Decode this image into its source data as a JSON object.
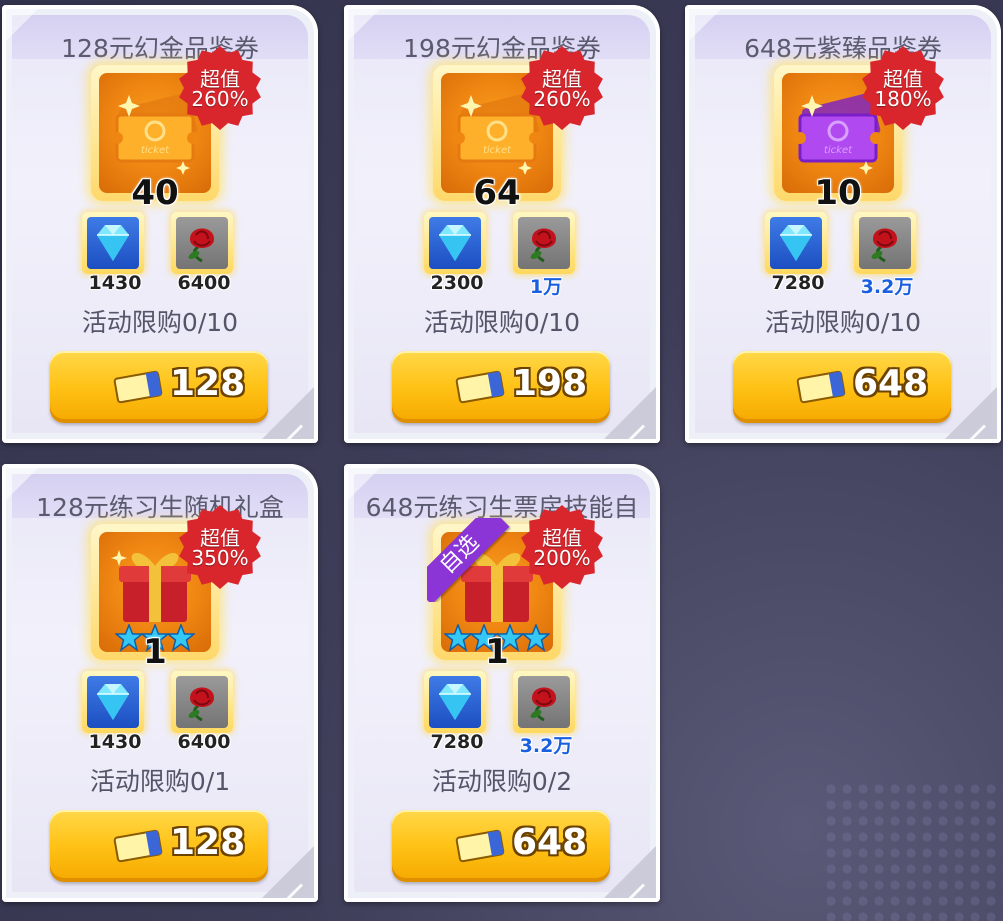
{
  "cards": [
    {
      "title": "128元幻金品鉴券",
      "item": "gold-ticket",
      "count": "40",
      "badge_top": "超值",
      "badge_bottom": "260%",
      "gem_value": "1430",
      "rose_value": "6400",
      "rose_value_highlight": false,
      "limit": "活动限购0/10",
      "price": "128",
      "stars": 0,
      "pick_label": ""
    },
    {
      "title": "198元幻金品鉴券",
      "item": "gold-ticket",
      "count": "64",
      "badge_top": "超值",
      "badge_bottom": "260%",
      "gem_value": "2300",
      "rose_value": "1万",
      "rose_value_highlight": true,
      "limit": "活动限购0/10",
      "price": "198",
      "stars": 0,
      "pick_label": ""
    },
    {
      "title": "648元紫臻品鉴券",
      "item": "purple-ticket",
      "count": "10",
      "badge_top": "超值",
      "badge_bottom": "180%",
      "gem_value": "7280",
      "rose_value": "3.2万",
      "rose_value_highlight": true,
      "limit": "活动限购0/10",
      "price": "648",
      "stars": 0,
      "pick_label": ""
    },
    {
      "title": "128元练习生随机礼盒",
      "item": "gift-box",
      "count": "1",
      "badge_top": "超值",
      "badge_bottom": "350%",
      "gem_value": "1430",
      "rose_value": "6400",
      "rose_value_highlight": false,
      "limit": "活动限购0/1",
      "price": "128",
      "stars": 3,
      "pick_label": ""
    },
    {
      "title": "648元练习生票房技能自",
      "item": "gift-box",
      "count": "1",
      "badge_top": "超值",
      "badge_bottom": "200%",
      "gem_value": "7280",
      "rose_value": "3.2万",
      "rose_value_highlight": true,
      "limit": "活动限购0/2",
      "price": "648",
      "stars": 4,
      "pick_label": "自选"
    }
  ],
  "coupon_label": "代金券",
  "colors": {
    "badge_red": "#d8262c",
    "button_yellow": "#ffc216",
    "gem_blue": "#1c4fc2",
    "purple_ribbon": "#8b35d6"
  }
}
